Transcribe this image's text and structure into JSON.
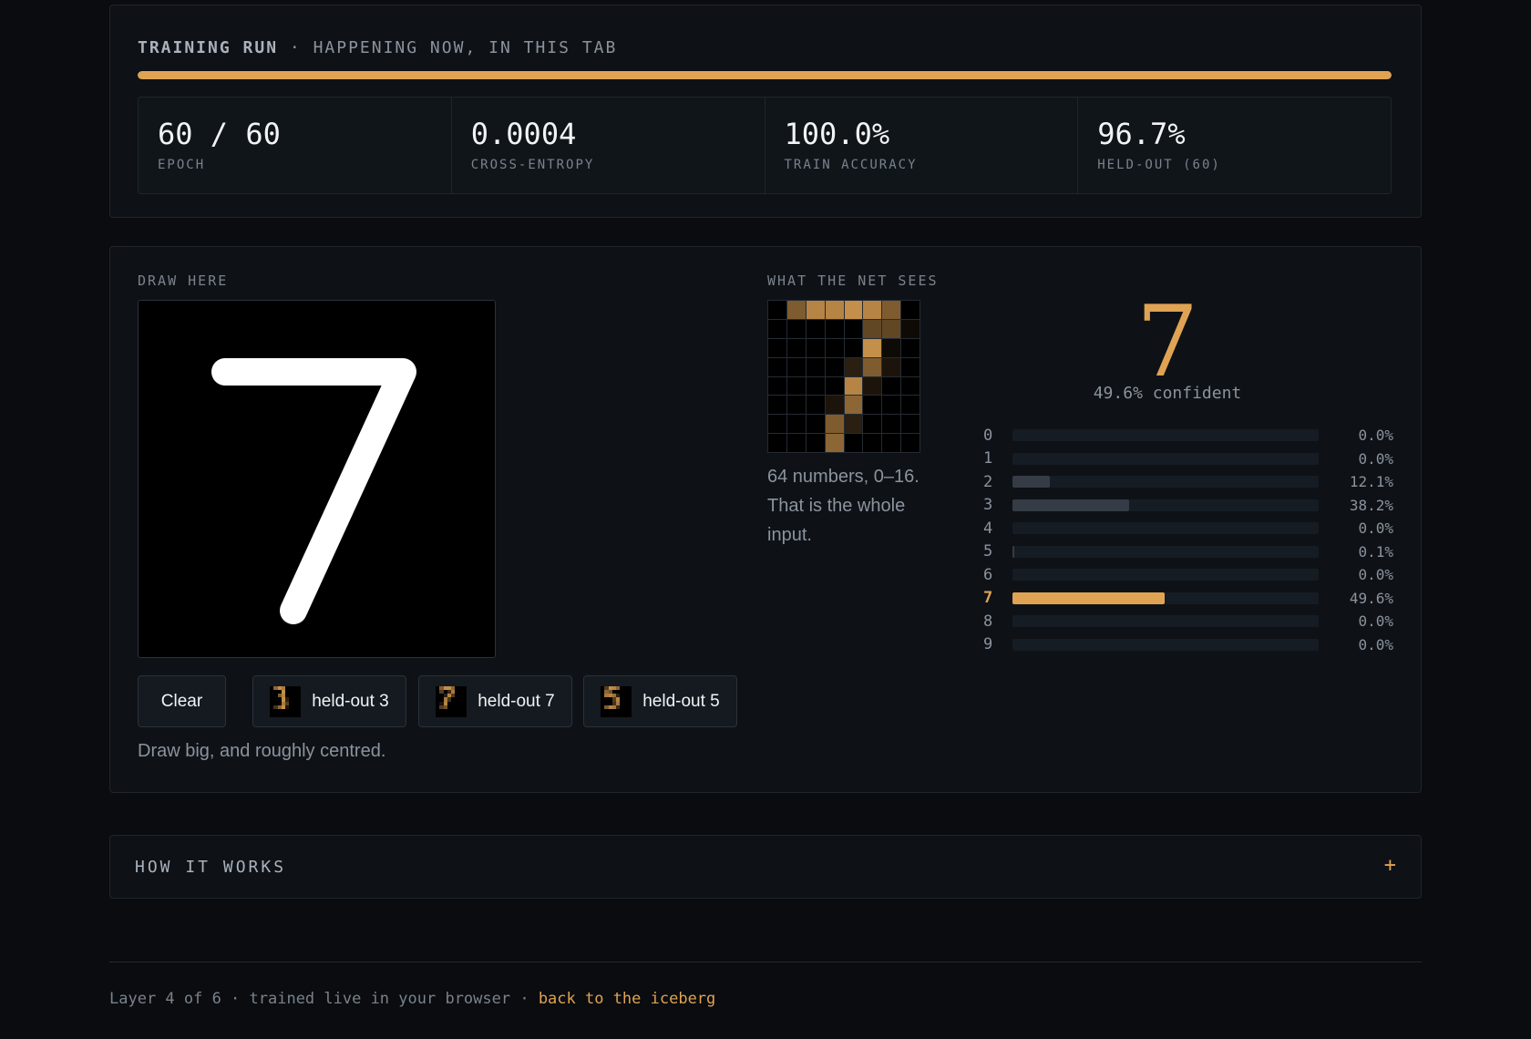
{
  "training": {
    "title": "TRAINING RUN",
    "subtitle": "· HAPPENING NOW, IN THIS TAB",
    "progress": 1.0,
    "stats": [
      {
        "value": "60 / 60",
        "label": "EPOCH"
      },
      {
        "value": "0.0004",
        "label": "CROSS-ENTROPY"
      },
      {
        "value": "100.0%",
        "label": "TRAIN ACCURACY"
      },
      {
        "value": "96.7%",
        "label": "HELD-OUT (60)"
      }
    ]
  },
  "draw": {
    "label": "DRAW HERE",
    "clear_label": "Clear",
    "samples": [
      {
        "label": "held-out 3"
      },
      {
        "label": "held-out 7"
      },
      {
        "label": "held-out 5"
      }
    ],
    "hint": "Draw big, and roughly centred."
  },
  "net": {
    "label": "WHAT THE NET SEES",
    "pixels": [
      0,
      9,
      13,
      13,
      14,
      13,
      9,
      0,
      0,
      0,
      0,
      0,
      0,
      7,
      7,
      1,
      0,
      0,
      0,
      0,
      0,
      14,
      1,
      0,
      0,
      0,
      0,
      0,
      3,
      9,
      2,
      0,
      0,
      0,
      0,
      0,
      13,
      2,
      0,
      0,
      0,
      0,
      0,
      2,
      10,
      0,
      0,
      0,
      0,
      0,
      0,
      9,
      3,
      0,
      0,
      0,
      0,
      0,
      0,
      10,
      0,
      0,
      0,
      0
    ],
    "caption": "64 numbers, 0–16. That is the whole input."
  },
  "prediction": {
    "digit": "7",
    "confidence": "49.6% confident",
    "probs": [
      {
        "digit": "0",
        "value": 0.0,
        "label": "0.0%"
      },
      {
        "digit": "1",
        "value": 0.0,
        "label": "0.0%"
      },
      {
        "digit": "2",
        "value": 12.1,
        "label": "12.1%"
      },
      {
        "digit": "3",
        "value": 38.2,
        "label": "38.2%"
      },
      {
        "digit": "4",
        "value": 0.0,
        "label": "0.0%"
      },
      {
        "digit": "5",
        "value": 0.1,
        "label": "0.1%"
      },
      {
        "digit": "6",
        "value": 0.0,
        "label": "0.0%"
      },
      {
        "digit": "7",
        "value": 49.6,
        "label": "49.6%"
      },
      {
        "digit": "8",
        "value": 0.0,
        "label": "0.0%"
      },
      {
        "digit": "9",
        "value": 0.0,
        "label": "0.0%"
      }
    ],
    "top_index": 7
  },
  "how_it_works": {
    "title": "HOW IT WORKS",
    "toggle": "+"
  },
  "footer": {
    "text": "Layer 4 of 6 · trained live in your browser · ",
    "link": "back to the iceberg"
  },
  "colors": {
    "accent": "#e0a354",
    "background": "#0a0c0f",
    "panel": "#0e1216"
  }
}
